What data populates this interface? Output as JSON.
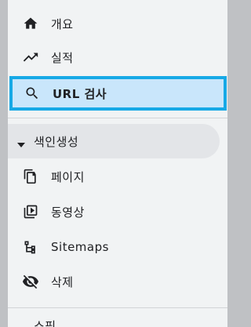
{
  "nav": {
    "items": [
      {
        "label": "개요",
        "icon": "home-icon"
      },
      {
        "label": "실적",
        "icon": "trending-up-icon"
      },
      {
        "label": "URL 검사",
        "icon": "search-icon"
      }
    ],
    "section": {
      "label": "색인생성",
      "icon": "caret-down-icon"
    },
    "section_items": [
      {
        "label": "페이지",
        "icon": "pages-icon"
      },
      {
        "label": "동영상",
        "icon": "video-pages-icon"
      },
      {
        "label": "Sitemaps",
        "icon": "sitemap-icon"
      },
      {
        "label": "삭제",
        "icon": "removals-icon"
      }
    ],
    "next_section_partial": "쇼핑"
  },
  "colors": {
    "active_bg": "#c9e6fb",
    "active_border": "#17a9e6",
    "panel_bg": "#f1f3f4",
    "text": "#202124"
  }
}
